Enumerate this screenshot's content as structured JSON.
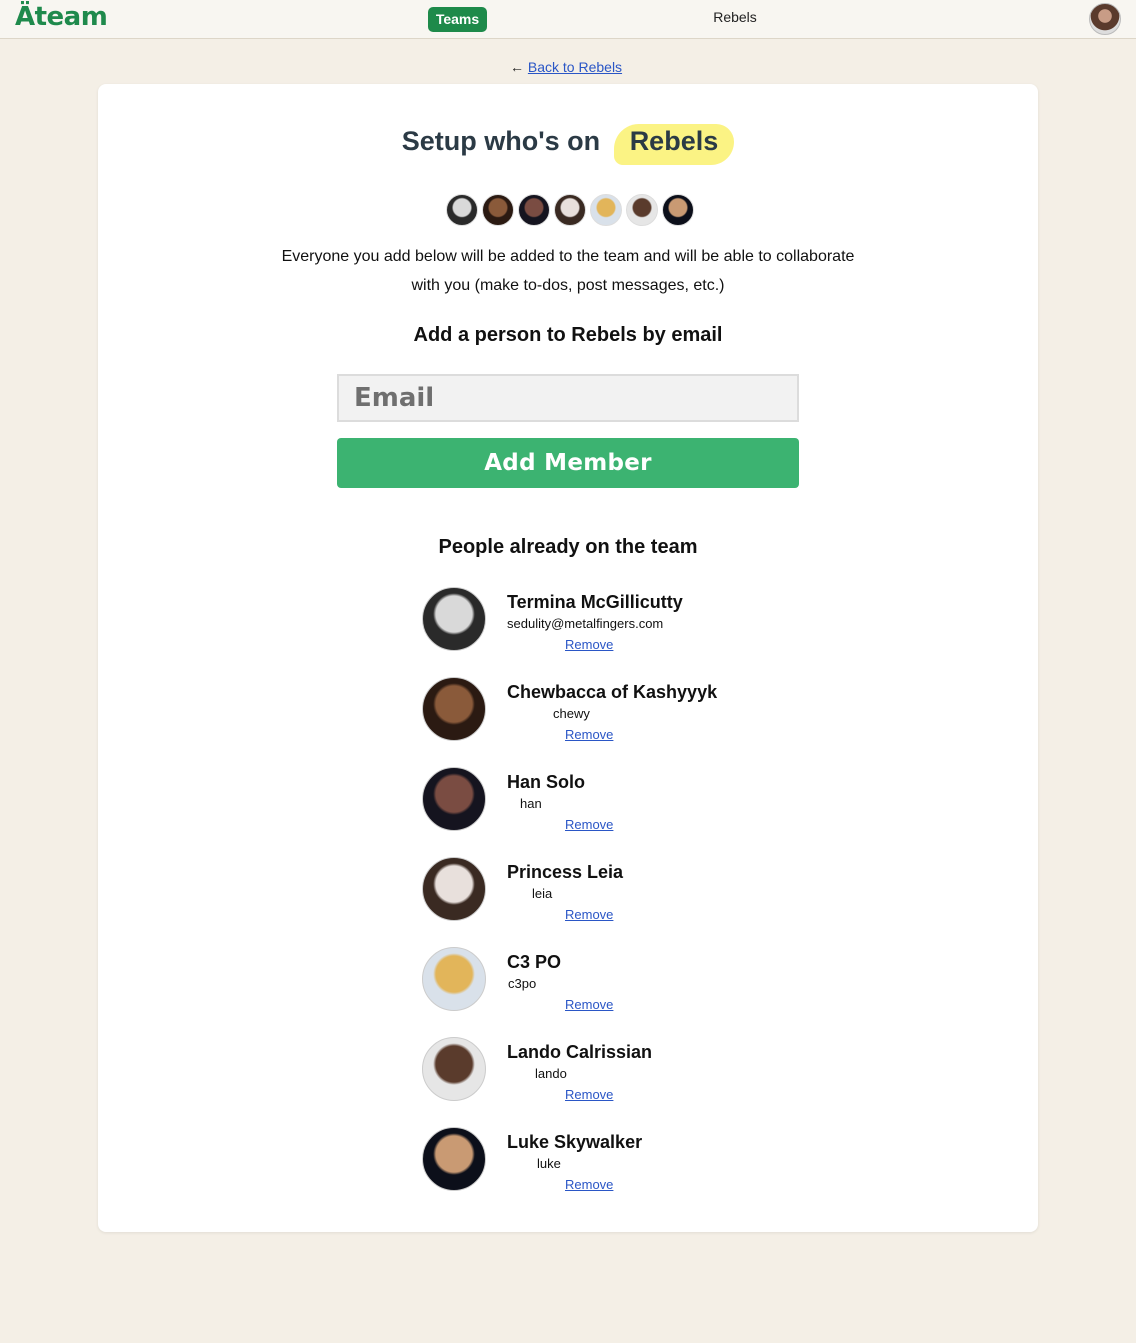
{
  "nav": {
    "logo": "Äteam",
    "teams_label": "Teams",
    "current_team": "Rebels"
  },
  "back_link": {
    "arrow": "←",
    "label": "Back to Rebels"
  },
  "setup": {
    "heading_prefix": "Setup who's on",
    "team_name": "Rebels",
    "intro": "Everyone you add below will be added to the team and will be able to collaborate with you (make to-dos, post messages, etc.)",
    "add_title": "Add a person to Rebels by email",
    "email_placeholder": "Email",
    "add_button": "Add Member",
    "people_title": "People already on the team"
  },
  "members": [
    {
      "name": "Termina McGillicutty",
      "handle": "sedulity@metalfingers.com",
      "remove": "Remove",
      "avatar_colors": [
        "#d9d9d9",
        "#2a2a2a"
      ]
    },
    {
      "name": "Chewbacca of Kashyyyk",
      "handle": "chewy",
      "remove": "Remove",
      "avatar_colors": [
        "#8a5a3a",
        "#2b1a12"
      ]
    },
    {
      "name": "Han Solo",
      "handle": "han",
      "remove": "Remove",
      "avatar_colors": [
        "#7a4c42",
        "#15141f"
      ]
    },
    {
      "name": "Princess Leia",
      "handle": "leia",
      "remove": "Remove",
      "avatar_colors": [
        "#e8e0dc",
        "#3a2a22"
      ]
    },
    {
      "name": "C3 PO",
      "handle": "c3po",
      "remove": "Remove",
      "avatar_colors": [
        "#e2b55a",
        "#d9e1ea"
      ]
    },
    {
      "name": "Lando Calrissian",
      "handle": "lando",
      "remove": "Remove",
      "avatar_colors": [
        "#5a3b2c",
        "#e6e6e6"
      ]
    },
    {
      "name": "Luke Skywalker",
      "handle": "luke",
      "remove": "Remove",
      "avatar_colors": [
        "#c99a73",
        "#0c0f1a"
      ]
    }
  ]
}
